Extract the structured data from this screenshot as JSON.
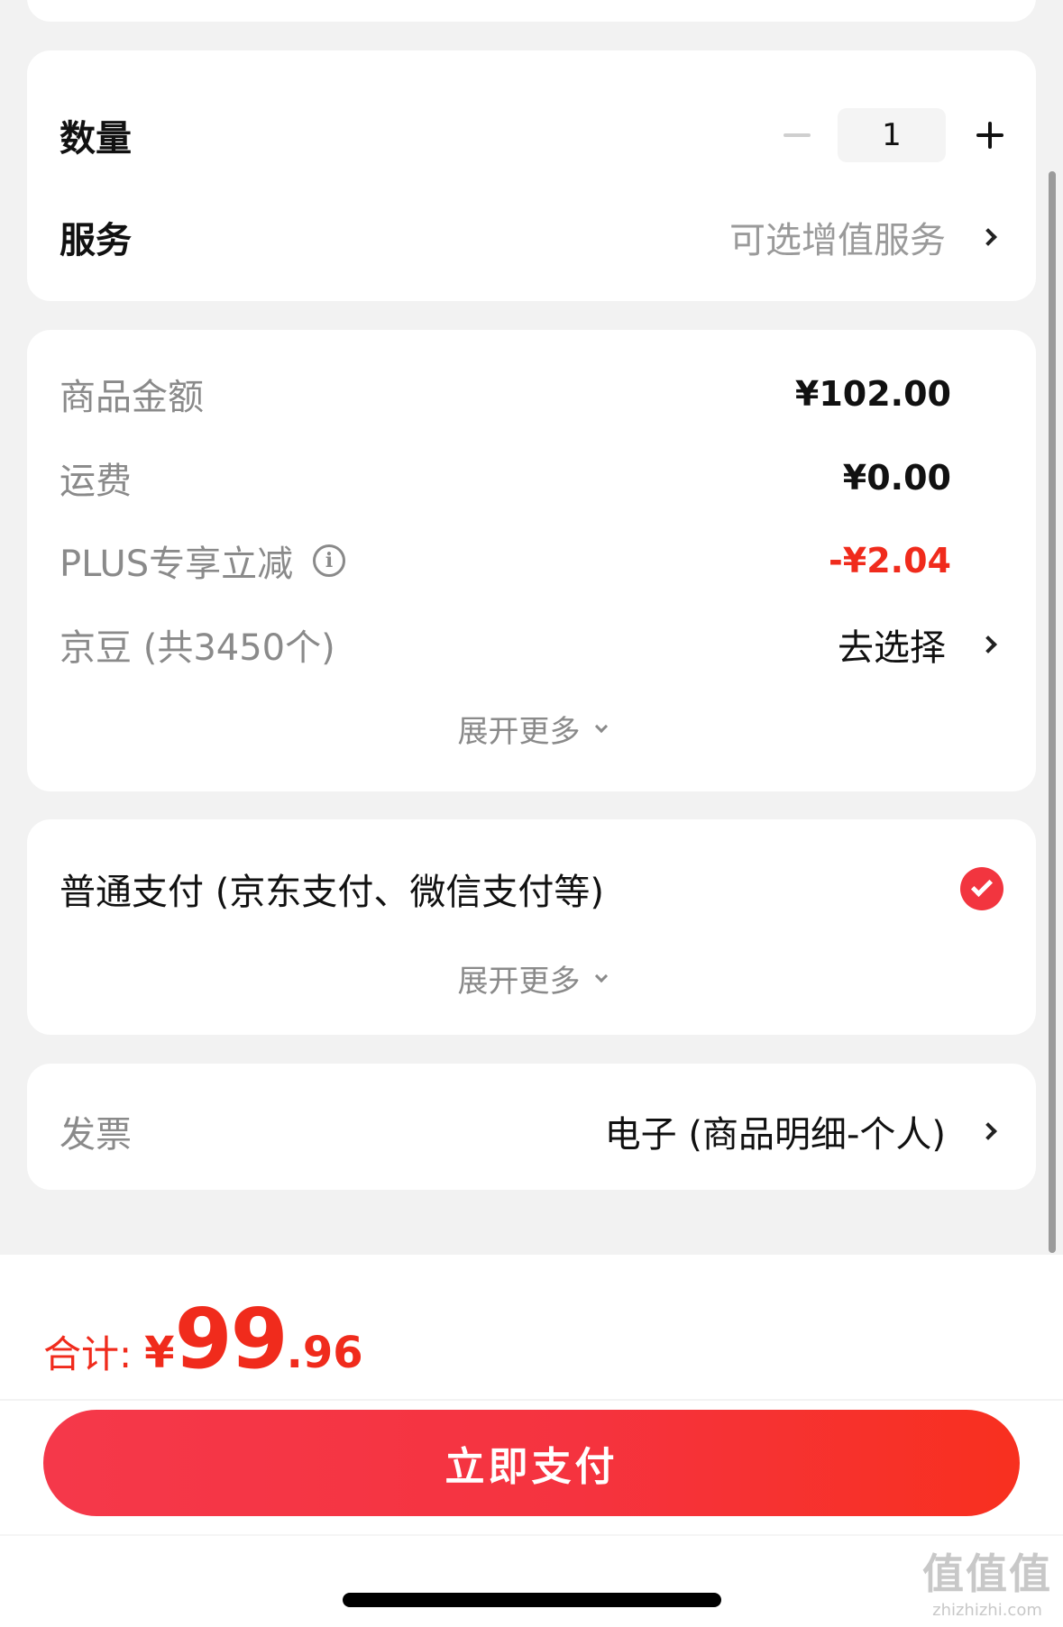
{
  "quantity_card": {
    "quantity_label": "数量",
    "quantity_value": "1",
    "service_label": "服务",
    "service_value": "可选增值服务"
  },
  "price_card": {
    "goods_amount_label": "商品金额",
    "goods_amount_value": "¥102.00",
    "shipping_label": "运费",
    "shipping_value": "¥0.00",
    "plus_label": "PLUS专享立减",
    "plus_value": "-¥2.04",
    "jingdou_label": "京豆 (共3450个)",
    "jingdou_value": "去选择",
    "expand_label": "展开更多"
  },
  "payment_card": {
    "method_label": "普通支付 (京东支付、微信支付等)",
    "expand_label": "展开更多"
  },
  "invoice_card": {
    "label": "发票",
    "value": "电子 (商品明细-个人)"
  },
  "footer": {
    "total_label": "合计:",
    "total_currency": "¥",
    "total_integer": "99",
    "total_decimal": ".96",
    "pay_button": "立即支付"
  },
  "watermark": {
    "main": "值值值",
    "sub": "zhizhizhi.com"
  },
  "colors": {
    "accent_red": "#f02b1c",
    "button_gradient_start": "#f5384a",
    "button_gradient_end": "#f8301f",
    "background": "#f2f2f2"
  }
}
